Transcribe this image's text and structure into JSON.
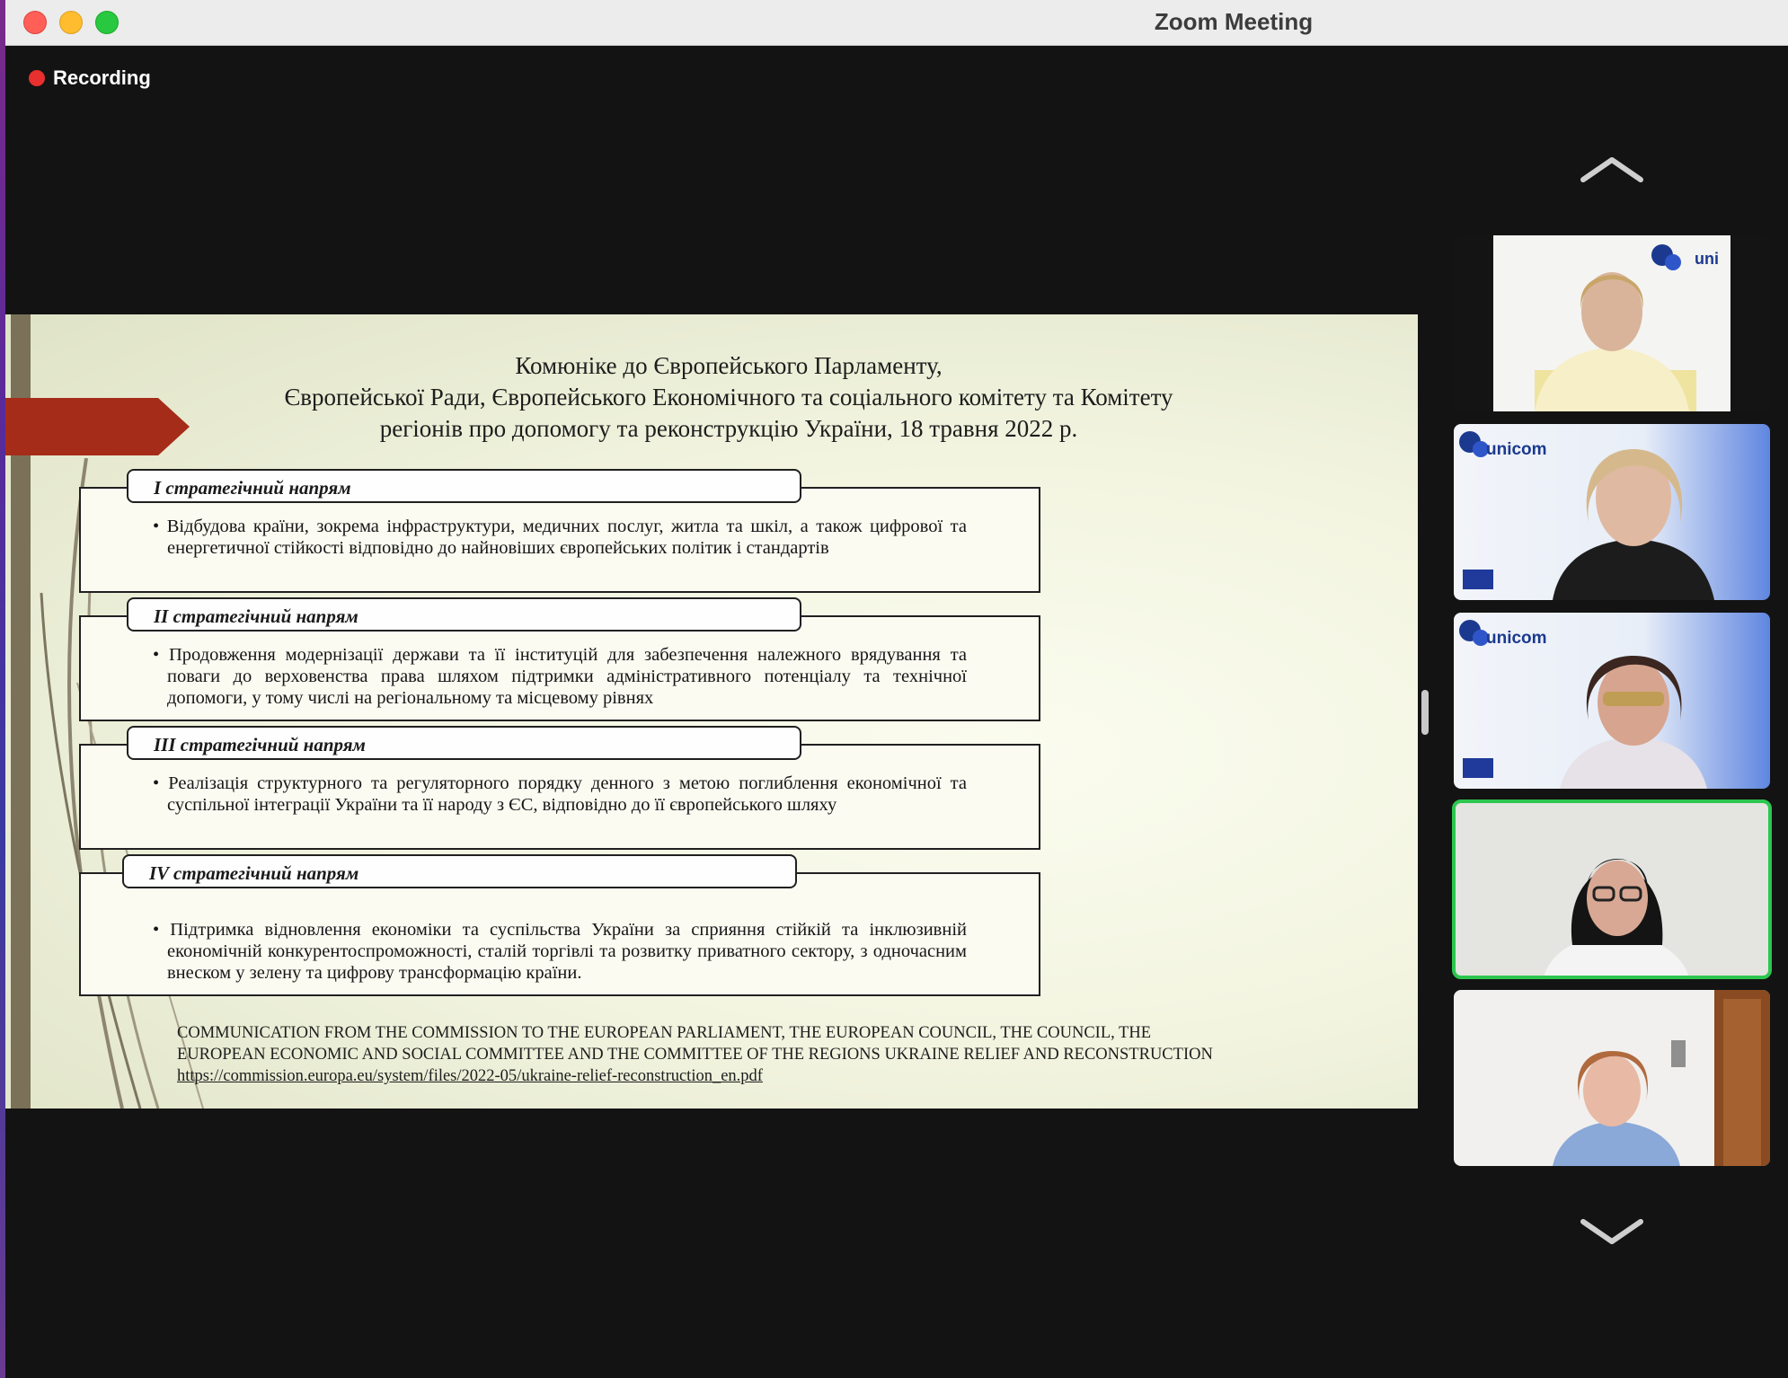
{
  "window": {
    "title": "Zoom Meeting"
  },
  "recording": {
    "label": "Recording"
  },
  "slide": {
    "title_lines": [
      "Комюніке до Європейського Парламенту,",
      "Європейської Ради, Європейського Економічного та соціального комітету та Комітету",
      "регіонів про допомогу та реконструкцію України, 18 травня 2022 р."
    ],
    "directions": [
      {
        "heading": "I стратегічний напрям",
        "text": "• Відбудова країни, зокрема інфраструктури, медичних послуг, житла та шкіл, а також цифрової та енергетичної стійкості відповідно до найновіших європейських політик і стандартів"
      },
      {
        "heading": "II стратегічний напрям",
        "text": "• Продовження модернізації держави та її інституцій для забезпечення належного врядування та поваги до верховенства права шляхом підтримки адміністративного потенціалу та технічної допомоги, у тому числі на регіональному та місцевому рівнях"
      },
      {
        "heading": "III стратегічний напрям",
        "text": "• Реалізація структурного та регуляторного порядку денного з метою поглиблення економічної та суспільної інтеграції України та її народу з ЄС, відповідно до її європейського шляху"
      },
      {
        "heading": "IV стратегічний напрям",
        "text": "• Підтримка відновлення економіки та суспільства України за сприяння стійкій та інклюзивній економічній конкурентоспроможності, сталій торгівлі та розвитку приватного сектору, з одночасним внеском у зелену та цифрову трансформацію країни."
      }
    ],
    "footer_line1": "COMMUNICATION FROM THE COMMISSION TO THE EUROPEAN PARLIAMENT, THE EUROPEAN COUNCIL, THE COUNCIL, THE",
    "footer_line2": "EUROPEAN ECONOMIC AND SOCIAL COMMITTEE AND THE COMMITTEE OF THE REGIONS UKRAINE RELIEF AND RECONSTRUCTION",
    "footer_link": "https://commission.europa.eu/system/files/2022-05/ukraine-relief-reconstruction_en.pdf",
    "colors": {
      "accent_arrow": "#a52c19",
      "frame_bar": "#7a7158"
    }
  },
  "participants": {
    "logo_text": "unicom",
    "logo_text_cropped": "uni",
    "active_speaker_color": "#2cc64f",
    "tiles": [
      {
        "id": 1,
        "background": "#f4f4f2"
      },
      {
        "id": 2,
        "background": "#e8eef8"
      },
      {
        "id": 3,
        "background": "#e8eef8"
      },
      {
        "id": 4,
        "background": "#e4e4e0",
        "active": true
      },
      {
        "id": 5,
        "background": "#f2f0ee"
      }
    ]
  },
  "icons": [
    "scroll-up-chevron-icon",
    "scroll-down-chevron-icon",
    "recording-dot-icon"
  ]
}
